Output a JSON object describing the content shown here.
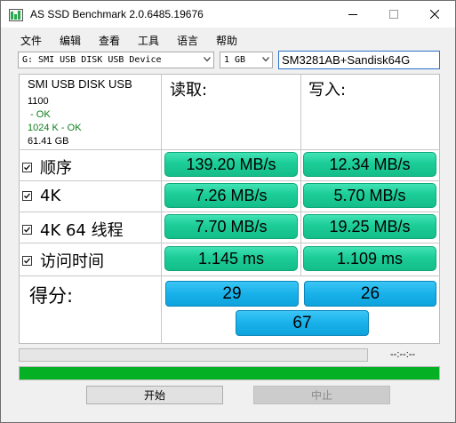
{
  "window": {
    "title": "AS SSD Benchmark 2.0.6485.19676"
  },
  "menu": [
    "文件",
    "编辑",
    "查看",
    "工具",
    "语言",
    "帮助"
  ],
  "toolbar": {
    "drive_select": "G: SMI USB DISK USB Device",
    "size_select": "1 GB",
    "name_input": "SM3281AB+Sandisk64G"
  },
  "drive_info": {
    "name": "SMI USB DISK USB",
    "firmware": "1100",
    "status1": " - OK",
    "status2": "1024 K - OK",
    "capacity": "61.41 GB"
  },
  "headers": {
    "read": "读取:",
    "write": "写入:"
  },
  "rows": [
    {
      "label": "顺序",
      "checked": true,
      "read": "139.20 MB/s",
      "write": "12.34 MB/s"
    },
    {
      "label": "4K",
      "checked": true,
      "read": "7.26 MB/s",
      "write": "5.70 MB/s"
    },
    {
      "label": "4K 64 线程",
      "checked": true,
      "read": "7.70 MB/s",
      "write": "19.25 MB/s"
    },
    {
      "label": "访问时间",
      "checked": true,
      "read": "1.145 ms",
      "write": "1.109 ms"
    }
  ],
  "score": {
    "label": "得分:",
    "read": "29",
    "write": "26",
    "total": "67"
  },
  "status": {
    "time": "--:--:--",
    "top_progress": 0,
    "bottom_progress": 1.0
  },
  "buttons": {
    "start": "开始",
    "stop": "中止"
  },
  "colors": {
    "result_green": "#1ccd98",
    "score_blue": "#19b1ea",
    "progress_green": "#06b025"
  }
}
